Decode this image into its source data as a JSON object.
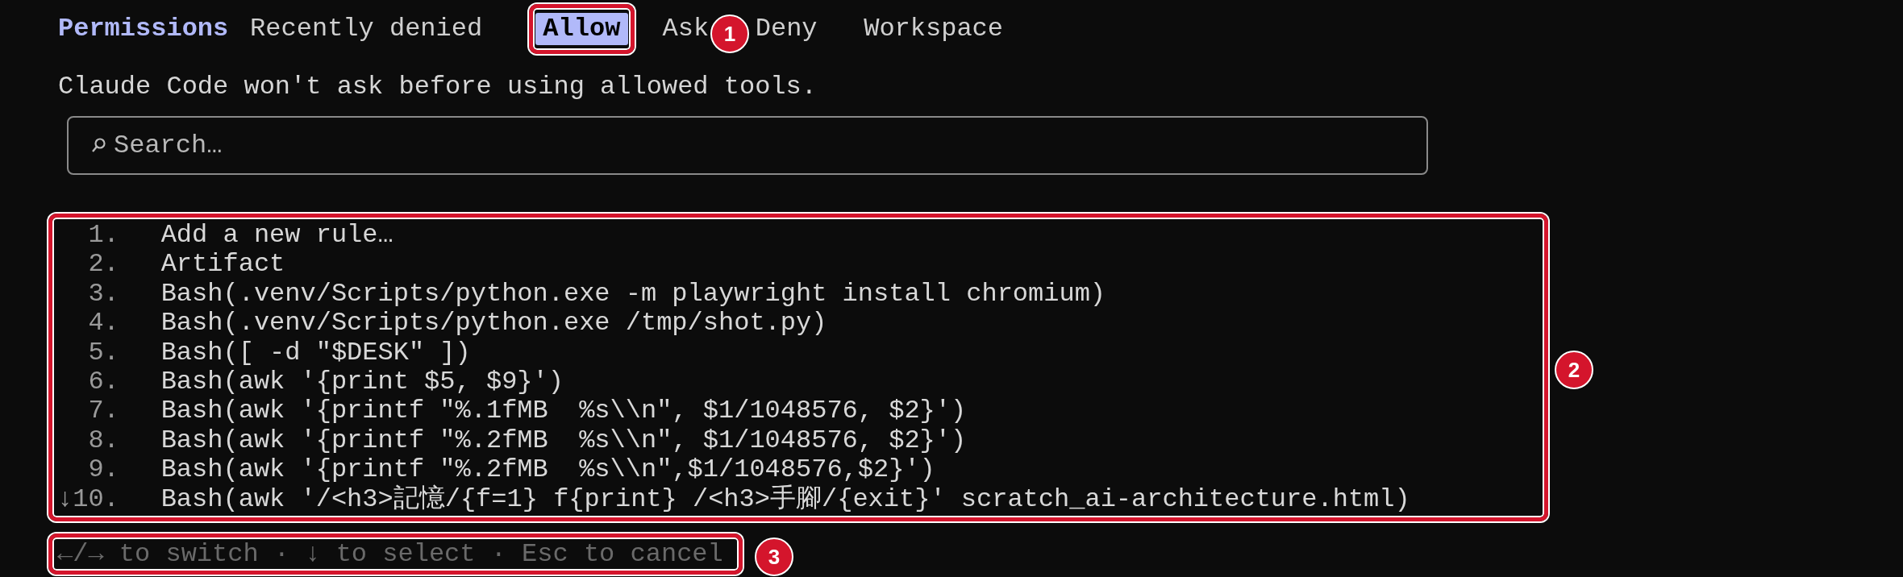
{
  "header": {
    "title": "Permissions"
  },
  "tabs": [
    {
      "label": "Recently denied",
      "selected": false
    },
    {
      "label": "Allow",
      "selected": true,
      "callout": "1"
    },
    {
      "label": "Ask",
      "selected": false
    },
    {
      "label": "Deny",
      "selected": false
    },
    {
      "label": "Workspace",
      "selected": false
    }
  ],
  "description": "Claude Code won't ask before using allowed tools.",
  "search": {
    "placeholder": "Search…"
  },
  "rules": {
    "callout": "2",
    "items": [
      {
        "number": "1.",
        "text": "Add a new rule…"
      },
      {
        "number": "2.",
        "text": "Artifact"
      },
      {
        "number": "3.",
        "text": "Bash(.venv/Scripts/python.exe -m playwright install chromium)"
      },
      {
        "number": "4.",
        "text": "Bash(.venv/Scripts/python.exe /tmp/shot.py)"
      },
      {
        "number": "5.",
        "text": "Bash([ -d \"$DESK\" ])"
      },
      {
        "number": "6.",
        "text": "Bash(awk '{print $5, $9}')"
      },
      {
        "number": "7.",
        "text": "Bash(awk '{printf \"%.1fMB  %s\\\\n\", $1/1048576, $2}')"
      },
      {
        "number": "8.",
        "text": "Bash(awk '{printf \"%.2fMB  %s\\\\n\", $1/1048576, $2}')"
      },
      {
        "number": "9.",
        "text": "Bash(awk '{printf \"%.2fMB  %s\\\\n\",$1/1048576,$2}')"
      },
      {
        "number": "10.",
        "text": "Bash(awk '/<h3>記憶/{f=1} f{print} /<h3>手腳/{exit}' scratch_ai-architecture.html)",
        "marker": "↓"
      }
    ]
  },
  "footer": {
    "hint": "←/→ to switch · ↓ to select · Esc to cancel",
    "callout": "3"
  }
}
